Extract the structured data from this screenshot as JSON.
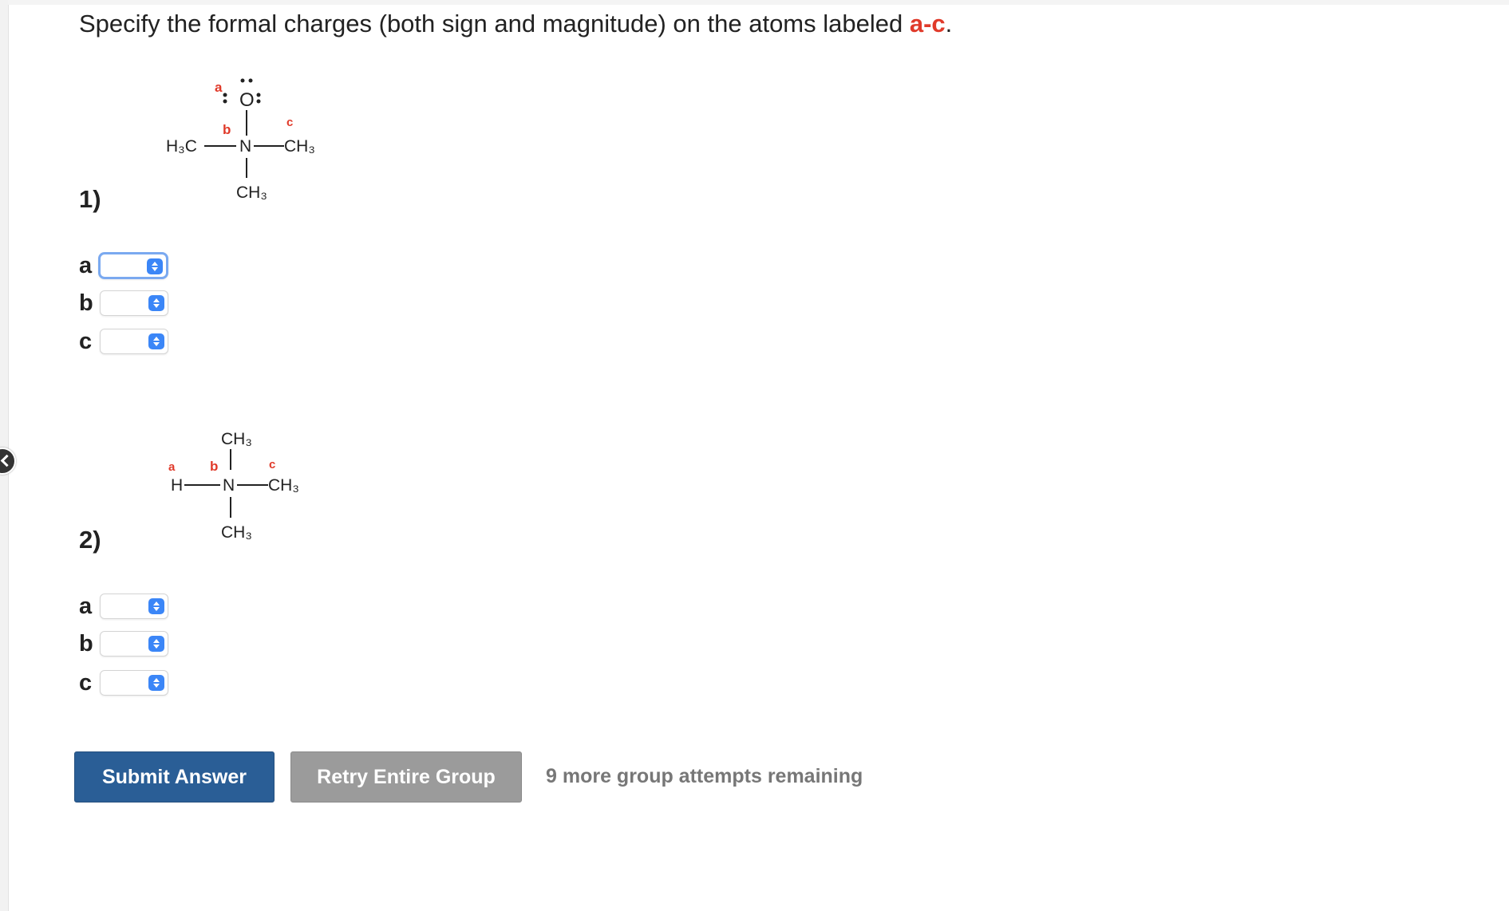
{
  "question": {
    "prefix": "Specify the formal charges (both sign and magnitude) on the atoms labeled ",
    "highlight": "a-c",
    "suffix": "."
  },
  "parts": [
    {
      "label": "1)",
      "structure": {
        "atom_labels": {
          "a": "a",
          "b": "b",
          "c": "c"
        },
        "atoms": {
          "top": "O",
          "center": "N",
          "left": "H₃C",
          "right": "CH₃",
          "bottom": "CH₃"
        }
      },
      "rows": [
        {
          "label": "a",
          "value": ""
        },
        {
          "label": "b",
          "value": ""
        },
        {
          "label": "c",
          "value": ""
        }
      ]
    },
    {
      "label": "2)",
      "structure": {
        "atom_labels": {
          "a": "a",
          "b": "b",
          "c": "c"
        },
        "atoms": {
          "top": "CH₃",
          "center": "N",
          "left": "H",
          "right": "CH₃",
          "bottom": "CH₃"
        }
      },
      "rows": [
        {
          "label": "a",
          "value": ""
        },
        {
          "label": "b",
          "value": ""
        },
        {
          "label": "c",
          "value": ""
        }
      ]
    }
  ],
  "buttons": {
    "submit": "Submit Answer",
    "retry": "Retry Entire Group"
  },
  "attempts_text": "9 more group attempts remaining",
  "colors": {
    "highlight": "#e03a2a",
    "submit_bg": "#2a5e96",
    "retry_bg": "#9b9b9b",
    "select_arrow": "#3b86f7"
  }
}
